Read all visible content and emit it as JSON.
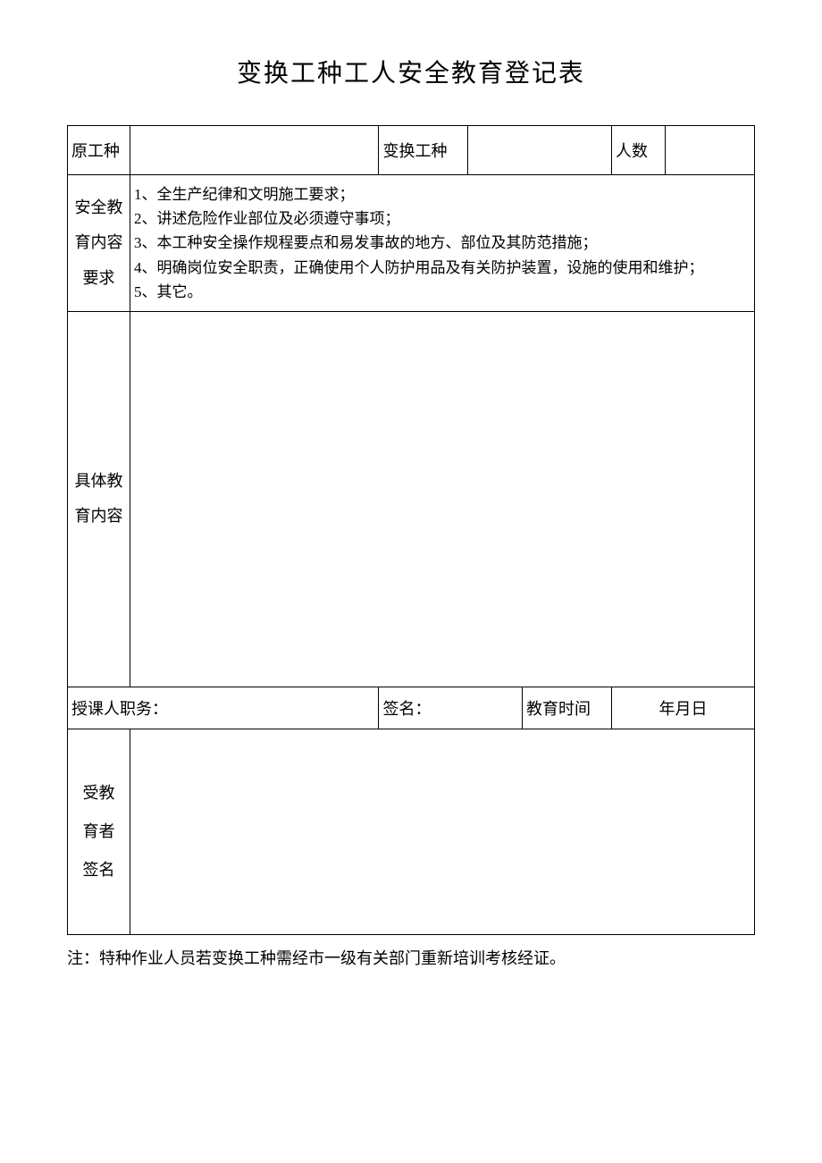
{
  "title": "变换工种工人安全教育登记表",
  "row1": {
    "label1": "原工种",
    "label2": "变换工种",
    "label3": "人数"
  },
  "requirements": {
    "label": "安全教\n育内容\n要求",
    "items": {
      "i1": "1、全生产纪律和文明施工要求；",
      "i2": "2、讲述危险作业部位及必须遵守事项；",
      "i3": "3、本工种安全操作规程要点和易发事故的地方、部位及其防范措施；",
      "i4": "4、明确岗位安全职责，正确使用个人防护用品及有关防护装置，设施的使用和维护；",
      "i5": "5、其它。"
    }
  },
  "detail": {
    "label": "具体教\n育内容"
  },
  "lecturer": {
    "position_label": "授课人职务：",
    "sign_label": "签名：",
    "time_label": "教育时间",
    "date": "年月日"
  },
  "signer": {
    "label": "受教\n育者\n签名"
  },
  "note": "注：特种作业人员若变换工种需经市一级有关部门重新培训考核经证。"
}
